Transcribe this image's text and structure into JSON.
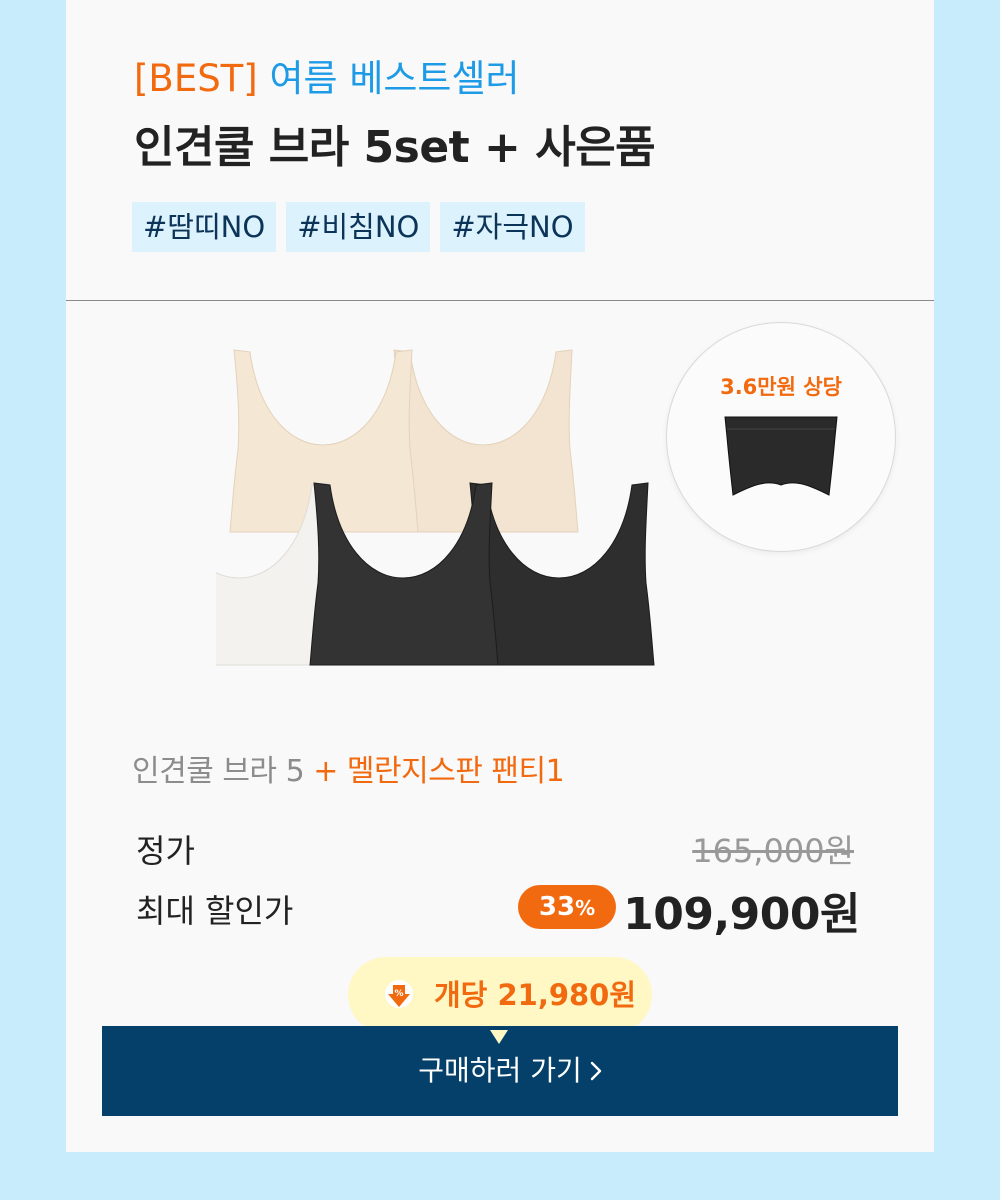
{
  "header": {
    "eyebrow_tag": "[BEST]",
    "eyebrow_text": "여름 베스트셀러",
    "title": "인견쿨 브라 5set + 사은품",
    "tags": [
      "#땀띠NO",
      "#비침NO",
      "#자극NO"
    ]
  },
  "gift": {
    "value_label": "3.6만원 상당"
  },
  "product": {
    "combo_main": "인견쿨 브라 5",
    "combo_plus": "+ 멜란지스판 팬티1"
  },
  "pricing": {
    "regular_label": "정가",
    "regular_price": "165,000원",
    "sale_label": "최대 할인가",
    "discount_value": "33",
    "discount_unit": "%",
    "sale_price": "109,900원",
    "per_item": "개당 21,980원"
  },
  "cta": {
    "label": "구매하러 가기"
  },
  "colors": {
    "background": "#c8ecfb",
    "accent_orange": "#f26a10",
    "accent_blue": "#1e9be6",
    "cta_navy": "#05406a",
    "tag_bg": "#dcf2fc",
    "bubble_bg": "#fff8c4"
  },
  "icons": {
    "discount": "percent-down-arrow-icon",
    "cta": "chevron-right-icon"
  }
}
